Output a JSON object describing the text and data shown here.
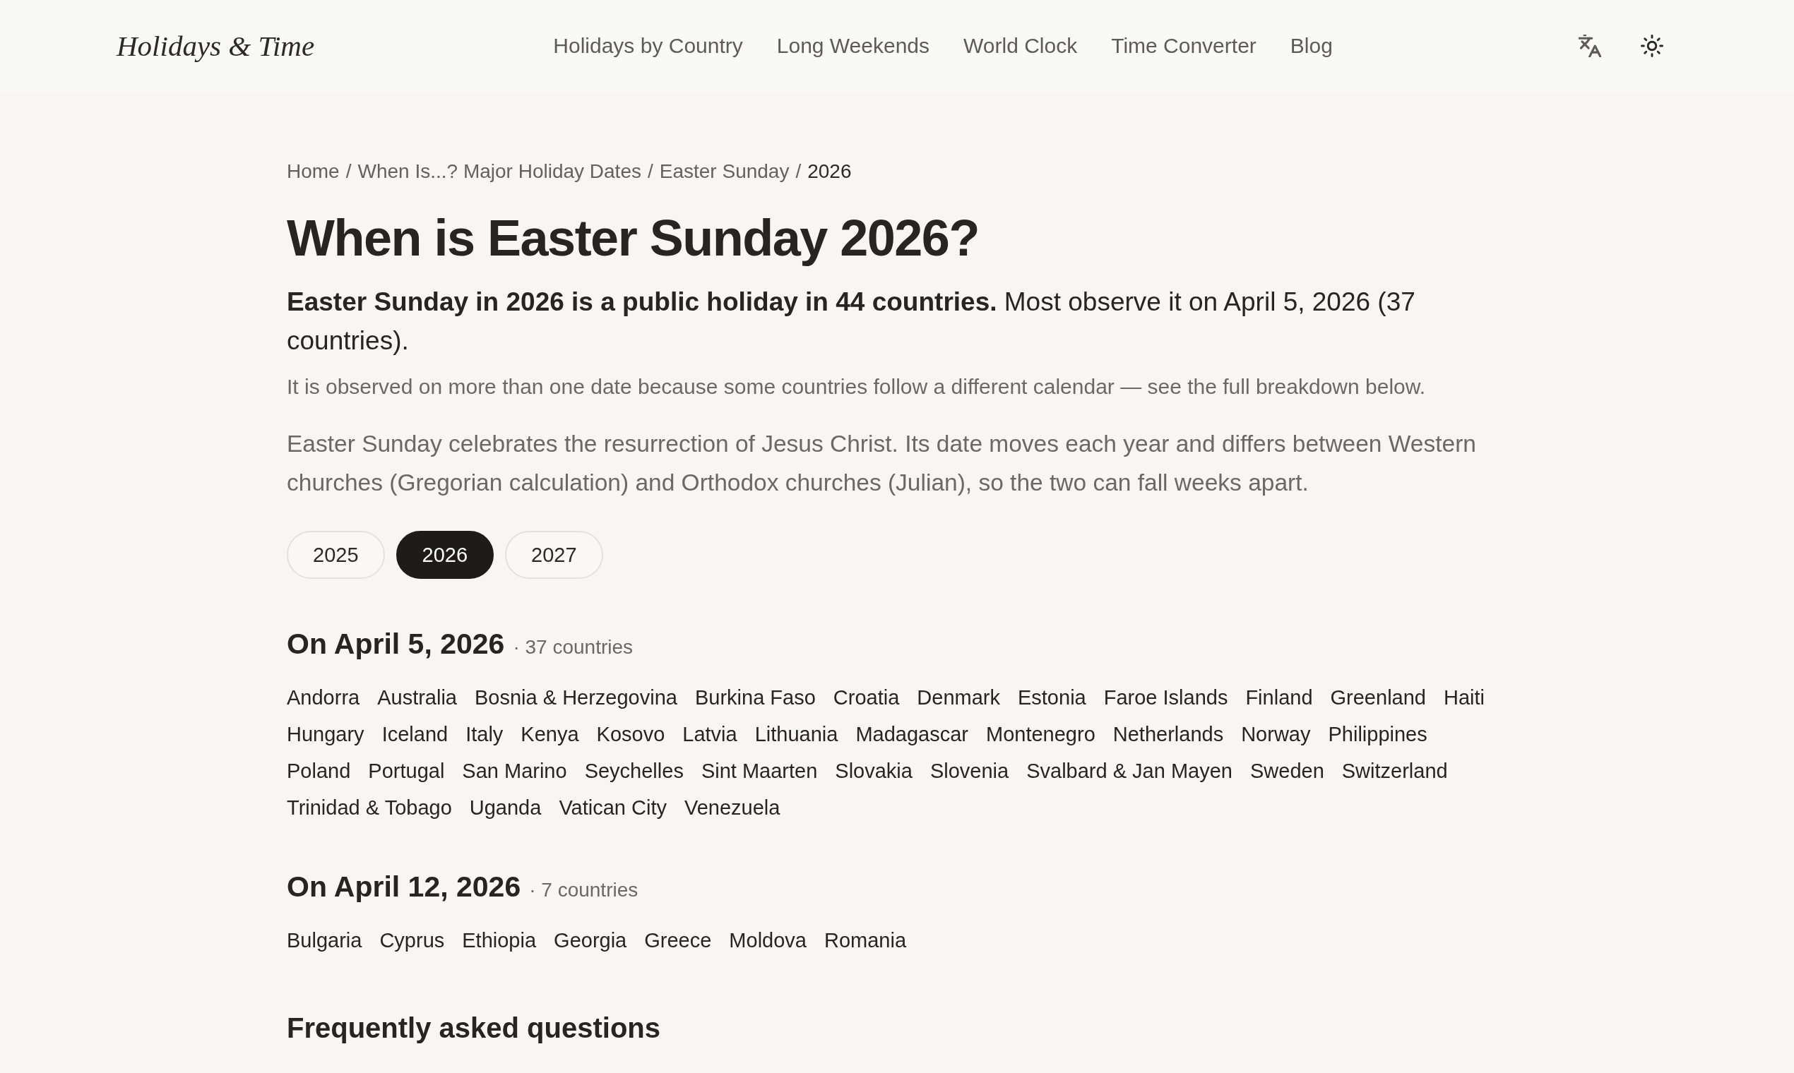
{
  "header": {
    "logo": "Holidays & Time",
    "nav": [
      "Holidays by Country",
      "Long Weekends",
      "World Clock",
      "Time Converter",
      "Blog"
    ],
    "actions": [
      {
        "kind": "language"
      },
      {
        "kind": "theme"
      }
    ]
  },
  "breadcrumb": {
    "separator": "/",
    "items": [
      {
        "label": "Home",
        "current": false
      },
      {
        "label": "When Is...? Major Holiday Dates",
        "current": false
      },
      {
        "label": "Easter Sunday",
        "current": false
      },
      {
        "label": "2026",
        "current": true
      }
    ]
  },
  "title": "When is Easter Sunday 2026?",
  "lead": "**Easter Sunday in 2026 is a public holiday in 44 countries.** Most observe it on April 5, 2026 (37 countries).",
  "note": "It is observed on more than one date because some countries follow a different calendar — see the full breakdown below.",
  "description": "Easter Sunday celebrates the resurrection of Jesus Christ. Its date moves each year and differs between Western churches (Gregorian calculation) and Orthodox churches (Julian), so the two can fall weeks apart.",
  "years": [
    {
      "label": "2025",
      "selected": false
    },
    {
      "label": "2026",
      "selected": true
    },
    {
      "label": "2027",
      "selected": false
    }
  ],
  "date_groups": [
    {
      "heading": "On April 5, 2026",
      "count": "· 37 countries",
      "countries": [
        "Andorra",
        "Australia",
        "Bosnia & Herzegovina",
        "Burkina Faso",
        "Croatia",
        "Denmark",
        "Estonia",
        "Faroe Islands",
        "Finland",
        "Greenland",
        "Haiti",
        "Hungary",
        "Iceland",
        "Italy",
        "Kenya",
        "Kosovo",
        "Latvia",
        "Lithuania",
        "Madagascar",
        "Montenegro",
        "Netherlands",
        "Norway",
        "Philippines",
        "Poland",
        "Portugal",
        "San Marino",
        "Seychelles",
        "Sint Maarten",
        "Slovakia",
        "Slovenia",
        "Svalbard & Jan Mayen",
        "Sweden",
        "Switzerland",
        "Trinidad & Tobago",
        "Uganda",
        "Vatican City",
        "Venezuela"
      ]
    },
    {
      "heading": "On April 12, 2026",
      "count": "· 7 countries",
      "countries": [
        "Bulgaria",
        "Cyprus",
        "Ethiopia",
        "Georgia",
        "Greece",
        "Moldova",
        "Romania"
      ]
    }
  ],
  "faq": {
    "heading": "Frequently asked questions"
  }
}
